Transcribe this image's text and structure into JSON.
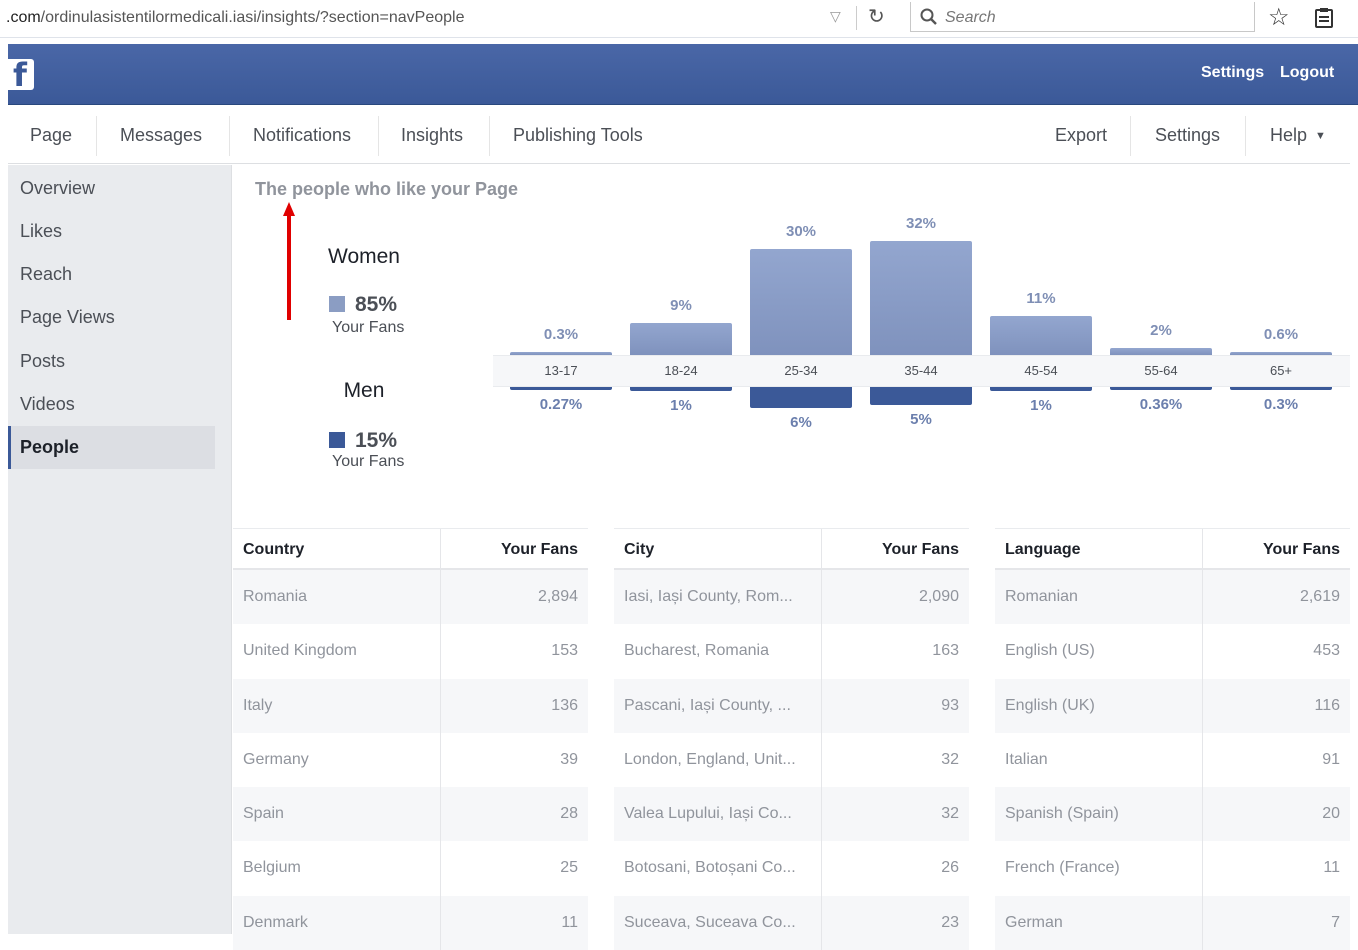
{
  "browser": {
    "url_domain": ".com",
    "url_path": "/ordinulasistentilormedicali.iasi/insights/?section=navPeople",
    "search_placeholder": "Search"
  },
  "topbar": {
    "settings_label": "Settings",
    "logout_label": "Logout",
    "logo": "f"
  },
  "tabs": [
    "Page",
    "Messages",
    "Notifications",
    "Insights",
    "Publishing Tools"
  ],
  "tabs_right": {
    "export": "Export",
    "settings": "Settings",
    "help": "Help"
  },
  "sidebar": {
    "items": [
      "Overview",
      "Likes",
      "Reach",
      "Page Views",
      "Posts",
      "Videos",
      "People"
    ],
    "active": "People"
  },
  "main": {
    "heading": "The people who like your Page",
    "women": {
      "title": "Women",
      "pct": "85%",
      "sub": "Your Fans",
      "color": "#8b9dc3"
    },
    "men": {
      "title": "Men",
      "pct": "15%",
      "sub": "Your Fans",
      "color": "#3b5998"
    },
    "annotation_arrow_color": "#e00000"
  },
  "chart_data": {
    "type": "bar",
    "categories": [
      "13-17",
      "18-24",
      "25-34",
      "35-44",
      "45-54",
      "55-64",
      "65+"
    ],
    "series": [
      {
        "name": "Women",
        "values": [
          0.3,
          9,
          30,
          32,
          11,
          2,
          0.6
        ],
        "labels": [
          "0.3%",
          "9%",
          "30%",
          "32%",
          "11%",
          "2%",
          "0.6%"
        ]
      },
      {
        "name": "Men",
        "values": [
          0.27,
          1,
          6,
          5,
          1,
          0.36,
          0.3
        ],
        "labels": [
          "0.27%",
          "1%",
          "6%",
          "5%",
          "1%",
          "0.36%",
          "0.3%"
        ]
      }
    ]
  },
  "tables": [
    {
      "col1": "Country",
      "col2": "Your Fans",
      "rows": [
        [
          "Romania",
          "2,894"
        ],
        [
          "United Kingdom",
          "153"
        ],
        [
          "Italy",
          "136"
        ],
        [
          "Germany",
          "39"
        ],
        [
          "Spain",
          "28"
        ],
        [
          "Belgium",
          "25"
        ],
        [
          "Denmark",
          "11"
        ]
      ]
    },
    {
      "col1": "City",
      "col2": "Your Fans",
      "rows": [
        [
          "Iasi, Iași County, Rom...",
          "2,090"
        ],
        [
          "Bucharest, Romania",
          "163"
        ],
        [
          "Pascani, Iași County, ...",
          "93"
        ],
        [
          "London, England, Unit...",
          "32"
        ],
        [
          "Valea Lupului, Iași Co...",
          "32"
        ],
        [
          "Botosani, Botoșani Co...",
          "26"
        ],
        [
          "Suceava, Suceava Co...",
          "23"
        ]
      ]
    },
    {
      "col1": "Language",
      "col2": "Your Fans",
      "rows": [
        [
          "Romanian",
          "2,619"
        ],
        [
          "English (US)",
          "453"
        ],
        [
          "English (UK)",
          "116"
        ],
        [
          "Italian",
          "91"
        ],
        [
          "Spanish (Spain)",
          "20"
        ],
        [
          "French (France)",
          "11"
        ],
        [
          "German",
          "7"
        ]
      ]
    }
  ]
}
